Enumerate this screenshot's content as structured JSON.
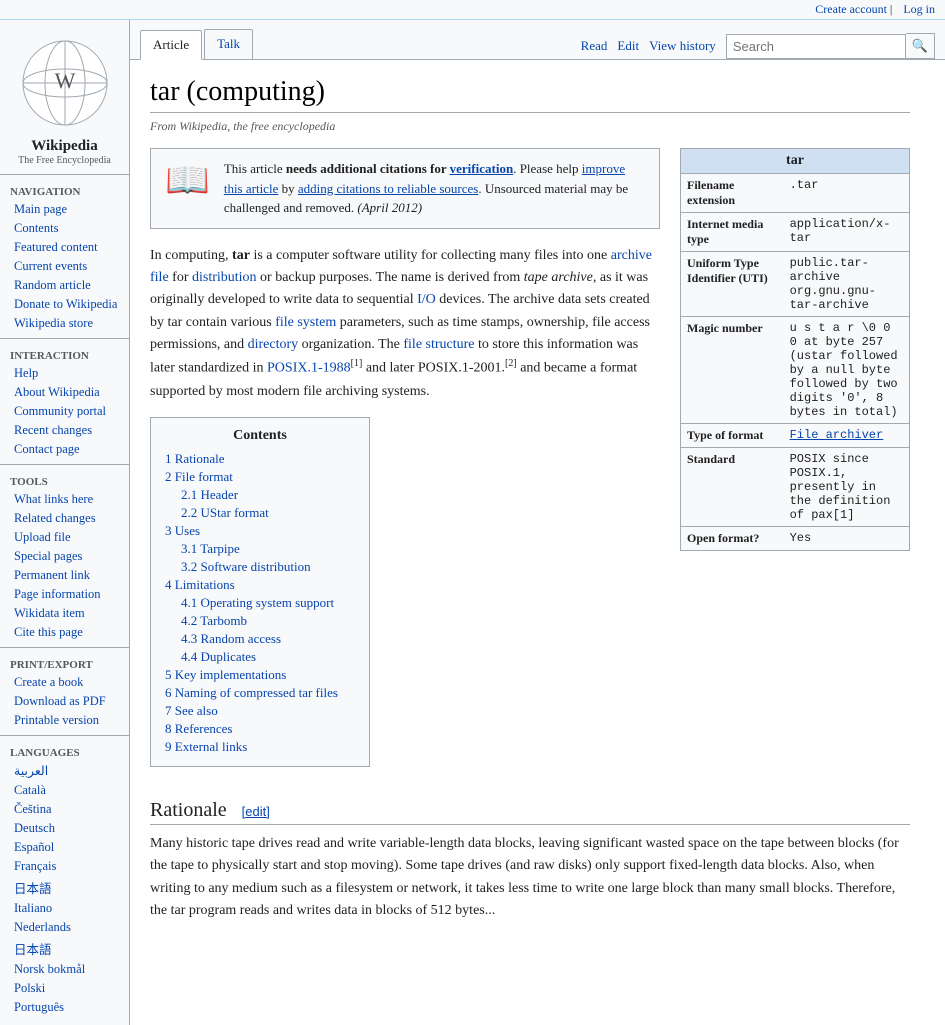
{
  "topbar": {
    "create_account": "Create account",
    "log_in": "Log in"
  },
  "sidebar": {
    "logo_alt": "Wikipedia",
    "wordmark": "Wikipedia",
    "tagline": "The Free Encyclopedia",
    "navigation_title": "Navigation",
    "nav_links": [
      {
        "label": "Main page",
        "href": "#"
      },
      {
        "label": "Contents",
        "href": "#"
      },
      {
        "label": "Featured content",
        "href": "#"
      },
      {
        "label": "Current events",
        "href": "#"
      },
      {
        "label": "Random article",
        "href": "#"
      },
      {
        "label": "Donate to Wikipedia",
        "href": "#"
      },
      {
        "label": "Wikipedia store",
        "href": "#"
      }
    ],
    "interaction_title": "Interaction",
    "interaction_links": [
      {
        "label": "Help",
        "href": "#"
      },
      {
        "label": "About Wikipedia",
        "href": "#"
      },
      {
        "label": "Community portal",
        "href": "#"
      },
      {
        "label": "Recent changes",
        "href": "#"
      },
      {
        "label": "Contact page",
        "href": "#"
      }
    ],
    "tools_title": "Tools",
    "tools_links": [
      {
        "label": "What links here",
        "href": "#"
      },
      {
        "label": "Related changes",
        "href": "#"
      },
      {
        "label": "Upload file",
        "href": "#"
      },
      {
        "label": "Special pages",
        "href": "#"
      },
      {
        "label": "Permanent link",
        "href": "#"
      },
      {
        "label": "Page information",
        "href": "#"
      },
      {
        "label": "Wikidata item",
        "href": "#"
      },
      {
        "label": "Cite this page",
        "href": "#"
      }
    ],
    "print_title": "Print/export",
    "print_links": [
      {
        "label": "Create a book",
        "href": "#"
      },
      {
        "label": "Download as PDF",
        "href": "#"
      },
      {
        "label": "Printable version",
        "href": "#"
      }
    ],
    "languages_title": "Languages",
    "language_links": [
      {
        "label": "العربية",
        "href": "#"
      },
      {
        "label": "Català",
        "href": "#"
      },
      {
        "label": "Čeština",
        "href": "#"
      },
      {
        "label": "Deutsch",
        "href": "#"
      },
      {
        "label": "Español",
        "href": "#"
      },
      {
        "label": "Français",
        "href": "#"
      },
      {
        "label": "日本語",
        "href": "#"
      },
      {
        "label": "Italiano",
        "href": "#"
      },
      {
        "label": "Nederlands",
        "href": "#"
      },
      {
        "label": "日本語",
        "href": "#"
      },
      {
        "label": "Norsk bokmål",
        "href": "#"
      },
      {
        "label": "Polski",
        "href": "#"
      },
      {
        "label": "Português",
        "href": "#"
      }
    ]
  },
  "tabs": {
    "article": "Article",
    "talk": "Talk",
    "read": "Read",
    "edit": "Edit",
    "view_history": "View history"
  },
  "search": {
    "placeholder": "Search",
    "button_label": "🔍"
  },
  "page": {
    "title": "tar (computing)",
    "subtitle": "From Wikipedia, the free encyclopedia",
    "citation_box": {
      "text_before": "This article ",
      "bold_text": "needs additional citations for",
      "link_text": "verification",
      "text_after": ". Please help ",
      "link2_text": "improve this article",
      "text2": " by ",
      "link3_text": "adding citations to reliable sources",
      "text3": ". Unsourced material may be challenged and removed.",
      "date": "(April 2012)"
    },
    "intro": "In computing, tar is a computer software utility for collecting many files into one archive file for distribution or backup purposes. The name is derived from tape archive, as it was originally developed to write data to sequential I/O devices. The archive data sets created by tar contain various file system parameters, such as time stamps, ownership, file access permissions, and directory organization. The file structure to store this information was later standardized in POSIX.1-1988[1] and later POSIX.1-2001.[2] and became a format supported by most modern file archiving systems.",
    "infobox": {
      "title": "tar",
      "rows": [
        {
          "label": "Filename extension",
          "value": ".tar"
        },
        {
          "label": "Internet media type",
          "value": "application/x-tar"
        },
        {
          "label": "Uniform Type Identifier (UTI)",
          "value": "public.tar-archive org.gnu.gnu-tar-archive"
        },
        {
          "label": "Magic number",
          "value": "u s t a r \\0 0 0 at byte 257 (ustar followed by a null byte followed by two digits '0', 8 bytes in total)"
        },
        {
          "label": "Type of format",
          "value": "File archiver"
        },
        {
          "label": "Standard",
          "value": "POSIX since POSIX.1, presently in the definition of pax[1]"
        },
        {
          "label": "Open format?",
          "value": "Yes"
        }
      ]
    },
    "contents": {
      "title": "Contents",
      "items": [
        {
          "num": "1",
          "label": "Rationale",
          "level": 1
        },
        {
          "num": "2",
          "label": "File format",
          "level": 1
        },
        {
          "num": "2.1",
          "label": "Header",
          "level": 2
        },
        {
          "num": "2.2",
          "label": "UStar format",
          "level": 2
        },
        {
          "num": "3",
          "label": "Uses",
          "level": 1
        },
        {
          "num": "3.1",
          "label": "Tarpipe",
          "level": 2
        },
        {
          "num": "3.2",
          "label": "Software distribution",
          "level": 2
        },
        {
          "num": "4",
          "label": "Limitations",
          "level": 1
        },
        {
          "num": "4.1",
          "label": "Operating system support",
          "level": 2
        },
        {
          "num": "4.2",
          "label": "Tarbomb",
          "level": 2
        },
        {
          "num": "4.3",
          "label": "Random access",
          "level": 2
        },
        {
          "num": "4.4",
          "label": "Duplicates",
          "level": 2
        },
        {
          "num": "5",
          "label": "Key implementations",
          "level": 1
        },
        {
          "num": "6",
          "label": "Naming of compressed tar files",
          "level": 1
        },
        {
          "num": "7",
          "label": "See also",
          "level": 1
        },
        {
          "num": "8",
          "label": "References",
          "level": 1
        },
        {
          "num": "9",
          "label": "External links",
          "level": 1
        }
      ]
    },
    "rationale_title": "Rationale",
    "rationale_edit": "[edit]",
    "rationale_text": "Many historic tape drives read and write variable-length data blocks, leaving significant wasted space on the tape between blocks (for the tape to physically start and stop moving). Some tape drives (and raw disks) only support fixed-length data blocks. Also, when writing to any medium such as a filesystem or network, it takes less time to write one large block than many small blocks. Therefore, the tar program reads and writes data in blocks of 512 bytes..."
  }
}
